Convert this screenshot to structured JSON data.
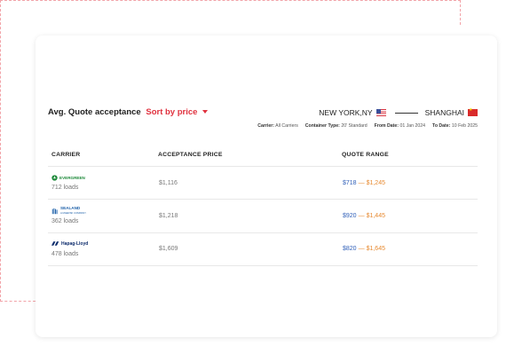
{
  "header": {
    "title": "Avg. Quote acceptance",
    "sort_label": "Sort by price"
  },
  "route": {
    "origin": "NEW YORK,NY",
    "destination": "SHANGHAI"
  },
  "filters": {
    "carrier_label": "Carrier:",
    "carrier_value": "All Carriers",
    "container_label": "Container Type:",
    "container_value": "20' Standard",
    "from_label": "From Date:",
    "from_value": "01 Jan 2024",
    "to_label": "To Date:",
    "to_value": "10 Feb 2025"
  },
  "table": {
    "columns": [
      "CARRIER",
      "ACCEPTANCE PRICE",
      "QUOTE RANGE"
    ],
    "rows": [
      {
        "carrier": "EVERGREEN",
        "loads": "712 loads",
        "price": "$1,116",
        "range_min": "$718",
        "range_sep": "—",
        "range_max": "$1,245"
      },
      {
        "carrier": "SEALAND",
        "carrier_sub": "A MAERSK COMPANY",
        "loads": "362 loads",
        "price": "$1,218",
        "range_min": "$920",
        "range_sep": "—",
        "range_max": "$1,445"
      },
      {
        "carrier": "Hapag-Lloyd",
        "loads": "478 loads",
        "price": "$1,609",
        "range_min": "$820",
        "range_sep": "—",
        "range_max": "$1,645"
      }
    ]
  },
  "colors": {
    "accent": "#e0323f",
    "range_min": "#2f5fb8",
    "range_max": "#e7892f",
    "evergreen": "#1f8a3b",
    "sealand": "#1b5fa8",
    "hapag": "#0b2a6b"
  }
}
